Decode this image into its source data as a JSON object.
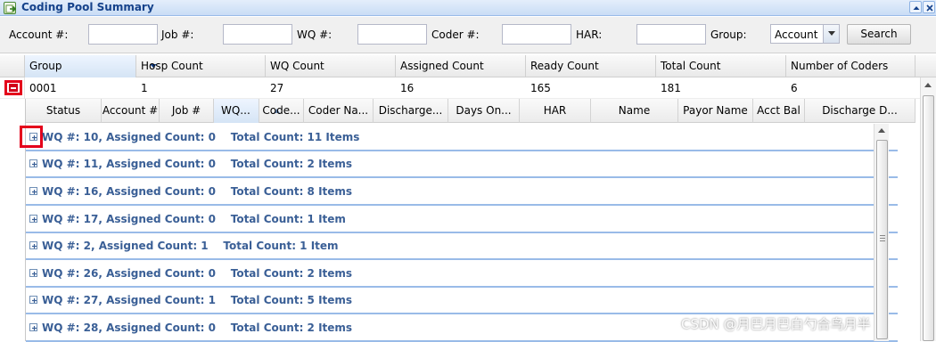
{
  "window": {
    "title": "Coding Pool Summary",
    "title_icon": "export-panel-icon",
    "tools": [
      "collapse-up-icon",
      "close-icon"
    ]
  },
  "filters": {
    "account_label": "Account #:",
    "account_value": "",
    "job_label": "Job #:",
    "job_value": "",
    "wq_label": "WQ #:",
    "wq_value": "",
    "coder_label": "Coder #:",
    "coder_value": "",
    "har_label": "HAR:",
    "har_value": "",
    "group_label": "Group:",
    "group_selected": "Account",
    "search_label": "Search"
  },
  "outer_grid": {
    "columns": [
      "Group",
      "Hosp Count",
      "WQ Count",
      "Assigned Count",
      "Ready Count",
      "Total Count",
      "Number of Coders"
    ],
    "row": {
      "group": "0001",
      "hosp_count": "1",
      "wq_count": "27",
      "assigned_count": "16",
      "ready_count": "165",
      "total_count": "181",
      "number_of_coders": "6",
      "expanded": true
    }
  },
  "inner_grid": {
    "columns": [
      "Status",
      "Account #",
      "Job #",
      "WQ...",
      "Code...",
      "Coder Na...",
      "Discharge...",
      "Days On...",
      "HAR",
      "Name",
      "Payor Name",
      "Acct Bal",
      "Discharge D..."
    ],
    "sorted_column": "WQ...",
    "groups": [
      {
        "label": "WQ #: 10, Assigned Count: 0",
        "total": "Total Count: 11 Items"
      },
      {
        "label": "WQ #: 11, Assigned Count: 0",
        "total": "Total Count: 2 Items"
      },
      {
        "label": "WQ #: 16, Assigned Count: 0",
        "total": "Total Count: 8 Items"
      },
      {
        "label": "WQ #: 17, Assigned Count: 0",
        "total": "Total Count: 1 Item"
      },
      {
        "label": "WQ #: 2, Assigned Count: 1",
        "total": "Total Count: 1 Item"
      },
      {
        "label": "WQ #: 26, Assigned Count: 0",
        "total": "Total Count: 2 Items"
      },
      {
        "label": "WQ #: 27, Assigned Count: 1",
        "total": "Total Count: 5 Items"
      },
      {
        "label": "WQ #: 28, Assigned Count: 0",
        "total": "Total Count: 2 Items"
      }
    ]
  },
  "colors": {
    "highlight": "#e4001b",
    "group_text": "#3a5f96",
    "title_text": "#15428b"
  },
  "watermark": "CSDN @月巴月巴白勺合鸟月半"
}
